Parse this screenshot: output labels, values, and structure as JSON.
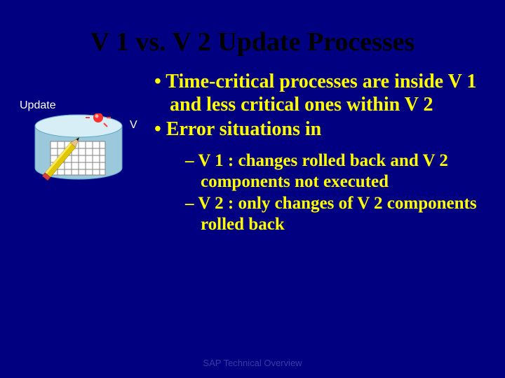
{
  "title": "V 1 vs. V 2 Update Processes",
  "left": {
    "update_label": "Update",
    "v_label": "V"
  },
  "bullets": {
    "b1": "Time-critical processes are inside V 1 and less critical ones within V 2",
    "b2": "Error situations in",
    "s1": "V 1 : changes rolled back and V 2 components not executed",
    "s2": "V 2 : only changes of V 2 components rolled back"
  },
  "footer": "SAP Technical Overview"
}
